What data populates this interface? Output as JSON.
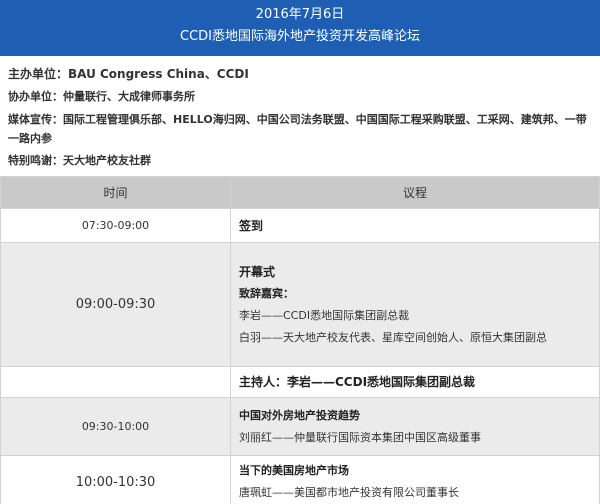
{
  "header": {
    "date": "2016年7月6日",
    "title": "CCDI悉地国际海外地产投资开发高峰论坛"
  },
  "info": {
    "host": "主办单位：BAU  Congress China、CCDI",
    "cohost": "协办单位：仲量联行、大成律师事务所",
    "media": "媒体宣传：国际工程管理俱乐部、HELLO海归网、中国公司法务联盟、中国国际工程采购联盟、工采网、建筑邦、一带一路内参",
    "thanks": "特别鸣谢：天大地产校友社群"
  },
  "agenda": {
    "col_time": "时间",
    "col_topic": "议程",
    "rows": [
      {
        "time": "07:30-09:00",
        "lines": [
          "签到"
        ]
      },
      {
        "time": "09:00-09:30",
        "lines": [
          "开幕式",
          "致辞嘉宾：",
          "李岩——CCDI悉地国际集团副总裁",
          "白羽——天大地产校友代表、星库空间创始人、原恒大集团副总"
        ]
      },
      {
        "time": "",
        "lines": [
          "主持人：李岩——CCDI悉地国际集团副总裁"
        ]
      },
      {
        "time": "09:30-10:00",
        "lines": [
          "中国对外房地产投资趋势",
          "刘丽红——仲量联行国际资本集团中国区高级董事"
        ]
      },
      {
        "time": "10:00-10:30",
        "lines": [
          "当下的美国房地产市场",
          "唐珮虹——美国都市地产投资有限公司董事长"
        ]
      }
    ]
  },
  "colors": {
    "header_bg": "#1f5fb3",
    "table_head_bg": "#c9c9c9",
    "row_alt_bg": "#ebebeb"
  }
}
